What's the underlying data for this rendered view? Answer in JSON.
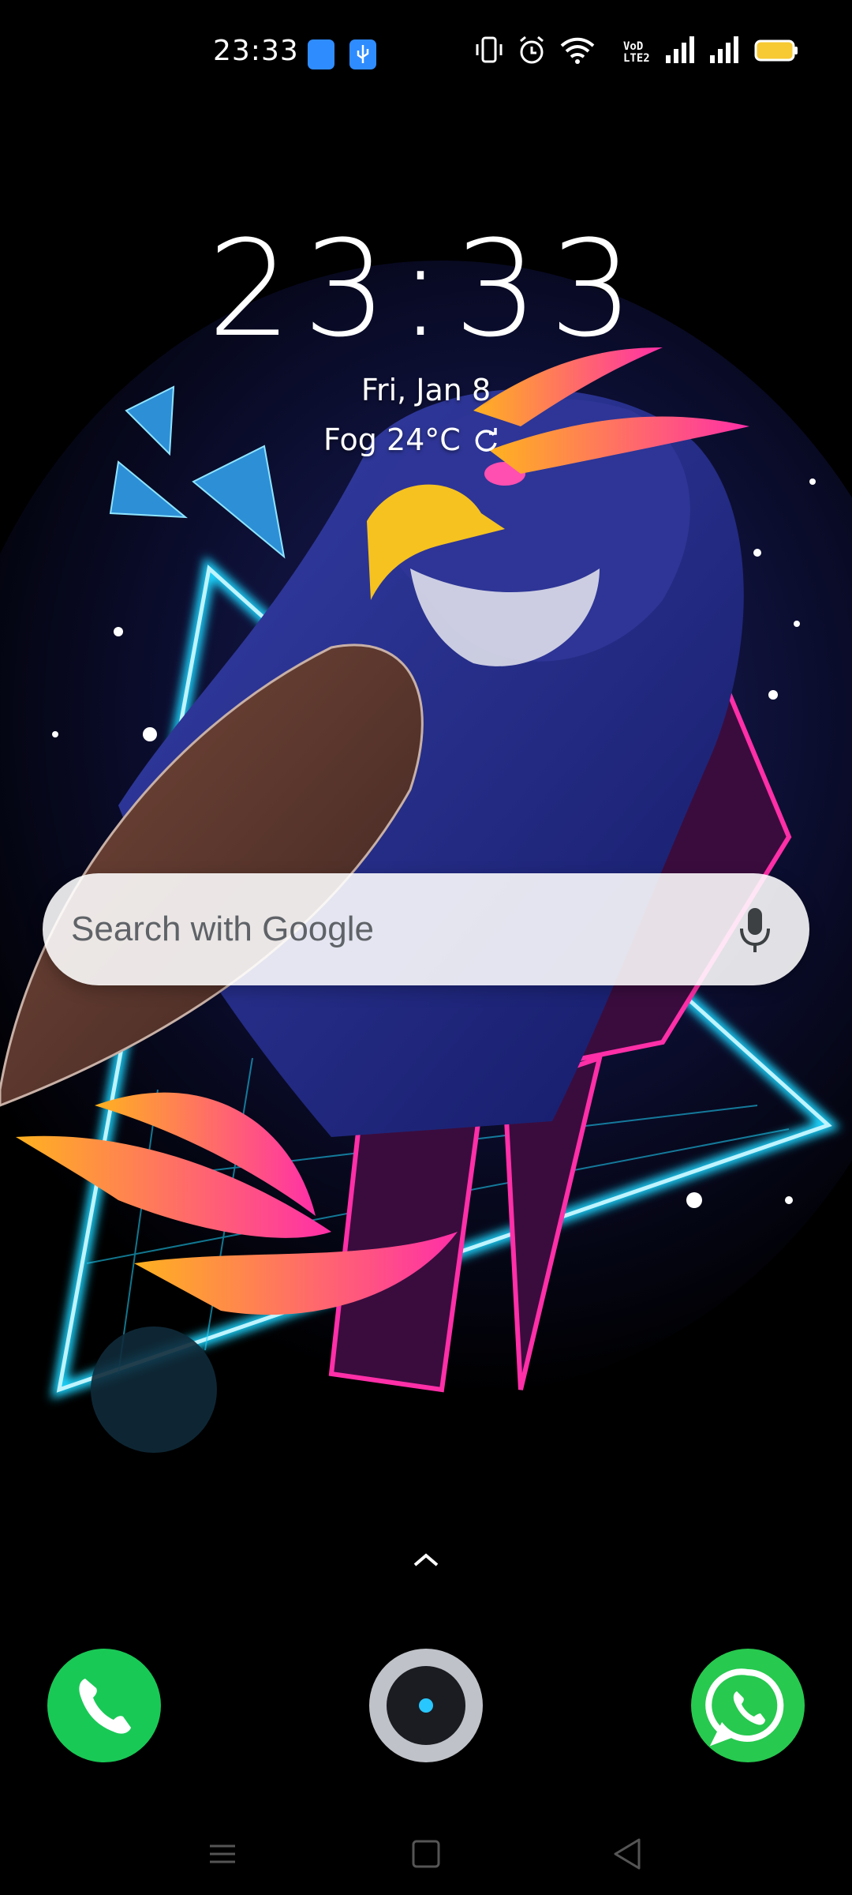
{
  "status_bar": {
    "time": "23:33",
    "network_label": "VoD\nLTE2",
    "icons": [
      "notification-app-icon",
      "usb-icon",
      "vibrate-icon",
      "alarm-icon",
      "wifi-icon",
      "volte-icon",
      "signal-icon",
      "signal-icon",
      "battery-icon"
    ],
    "battery_color": "#f7c933"
  },
  "lockscreen": {
    "clock": "23:33",
    "date": "Fri, Jan 8",
    "weather": "Fog 24°C"
  },
  "search": {
    "placeholder": "Search with Google",
    "mic_icon": "microphone-icon"
  },
  "dock": {
    "apps": [
      {
        "name": "Phone",
        "icon": "phone-icon",
        "color": "#19c956"
      },
      {
        "name": "Camera",
        "icon": "camera-icon",
        "color": "#bfc2c8"
      },
      {
        "name": "WhatsApp",
        "icon": "whatsapp-icon",
        "color": "#27c94f"
      }
    ]
  },
  "navigation": {
    "buttons": [
      "menu-icon",
      "home-icon",
      "back-icon"
    ]
  },
  "wallpaper": {
    "subject": "neon-eagle-wallpaper",
    "accent_colors": [
      "#1fd6ff",
      "#ff2fa8",
      "#ffb21f",
      "#2a2f9a"
    ]
  }
}
